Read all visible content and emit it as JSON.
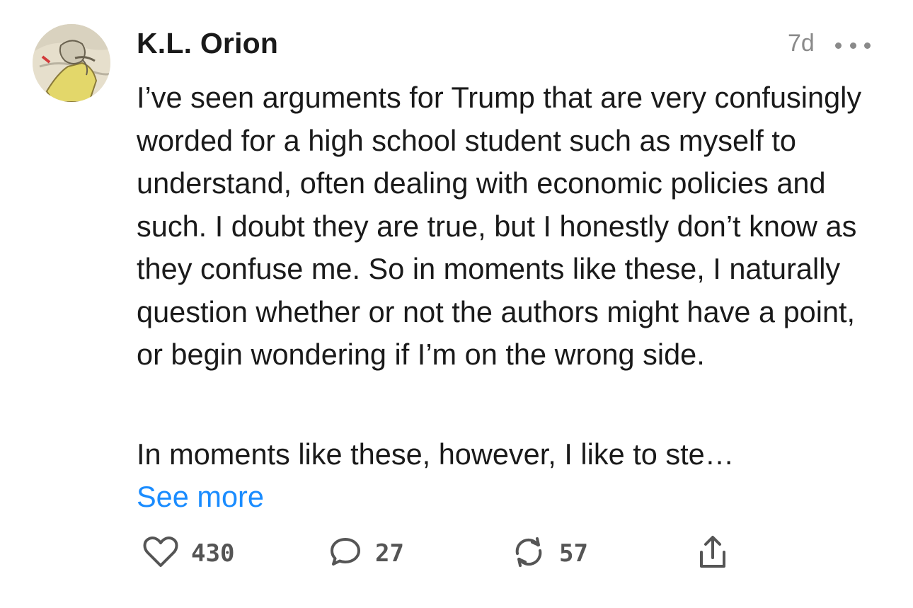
{
  "post": {
    "author": "K.L. Orion",
    "timestamp": "7d",
    "paragraph1": "I’ve seen arguments for Trump that are very confusingly worded for a high school student such as myself to understand, often dealing with economic policies and such. I doubt they are true, but I honestly don’t know as they confuse me. So in moments like these, I naturally question whether or not the authors might have a point, or begin wondering if I’m on the wrong side.",
    "paragraph2": "In moments like these, however, I like to ste…",
    "see_more_label": "See more"
  },
  "actions": {
    "likes": "430",
    "comments": "27",
    "restacks": "57"
  },
  "icons": {
    "like": "heart-icon",
    "comment": "speech-bubble-icon",
    "restack": "restack-icon",
    "share": "share-icon",
    "more": "ellipsis-icon"
  },
  "colors": {
    "link": "#1a8cff",
    "muted": "#8a8a8a",
    "text": "#1a1a1a"
  }
}
